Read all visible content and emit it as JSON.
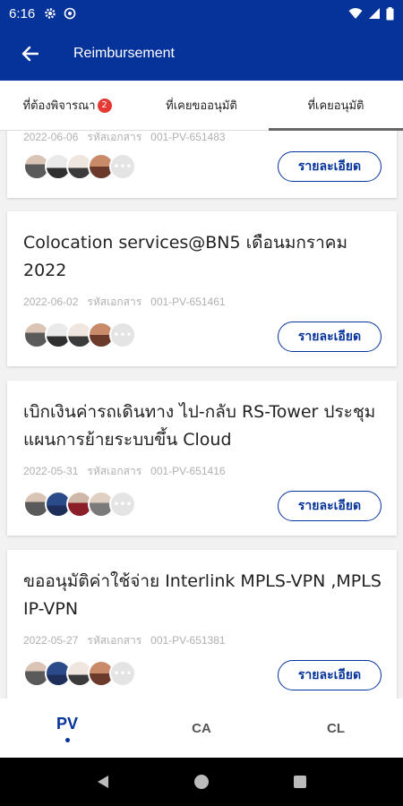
{
  "status_bar": {
    "time": "6:16"
  },
  "app_bar": {
    "title": "Reimbursement"
  },
  "tabs": [
    {
      "label": "ที่ต้องพิจารณา",
      "badge": "2"
    },
    {
      "label": "ที่เคยขออนุมัติ"
    },
    {
      "label": "ที่เคยอนุมัติ"
    }
  ],
  "cards": [
    {
      "title": "",
      "date": "2022-06-06",
      "doc_label": "รหัสเอกสาร",
      "doc_no": "001-PV-651483",
      "button": "รายละเอียด"
    },
    {
      "title": "Colocation services@BN5 เดือนมกราคม 2022",
      "date": "2022-06-02",
      "doc_label": "รหัสเอกสาร",
      "doc_no": "001-PV-651461",
      "button": "รายละเอียด"
    },
    {
      "title": "เบิกเงินค่ารถเดินทาง ไป-กลับ RS-Tower ประชุมแผนการย้ายระบบขึ้น Cloud",
      "date": "2022-05-31",
      "doc_label": "รหัสเอกสาร",
      "doc_no": "001-PV-651416",
      "button": "รายละเอียด"
    },
    {
      "title": "ขออนุมัติค่าใช้จ่าย Interlink MPLS-VPN ,MPLS IP-VPN",
      "date": "2022-05-27",
      "doc_label": "รหัสเอกสาร",
      "doc_no": "001-PV-651381",
      "button": "รายละเอียด"
    }
  ],
  "bottom_nav": [
    {
      "label": "PV"
    },
    {
      "label": "CA"
    },
    {
      "label": "CL"
    }
  ],
  "colors": {
    "primary": "#053399",
    "badge": "#e53935"
  }
}
